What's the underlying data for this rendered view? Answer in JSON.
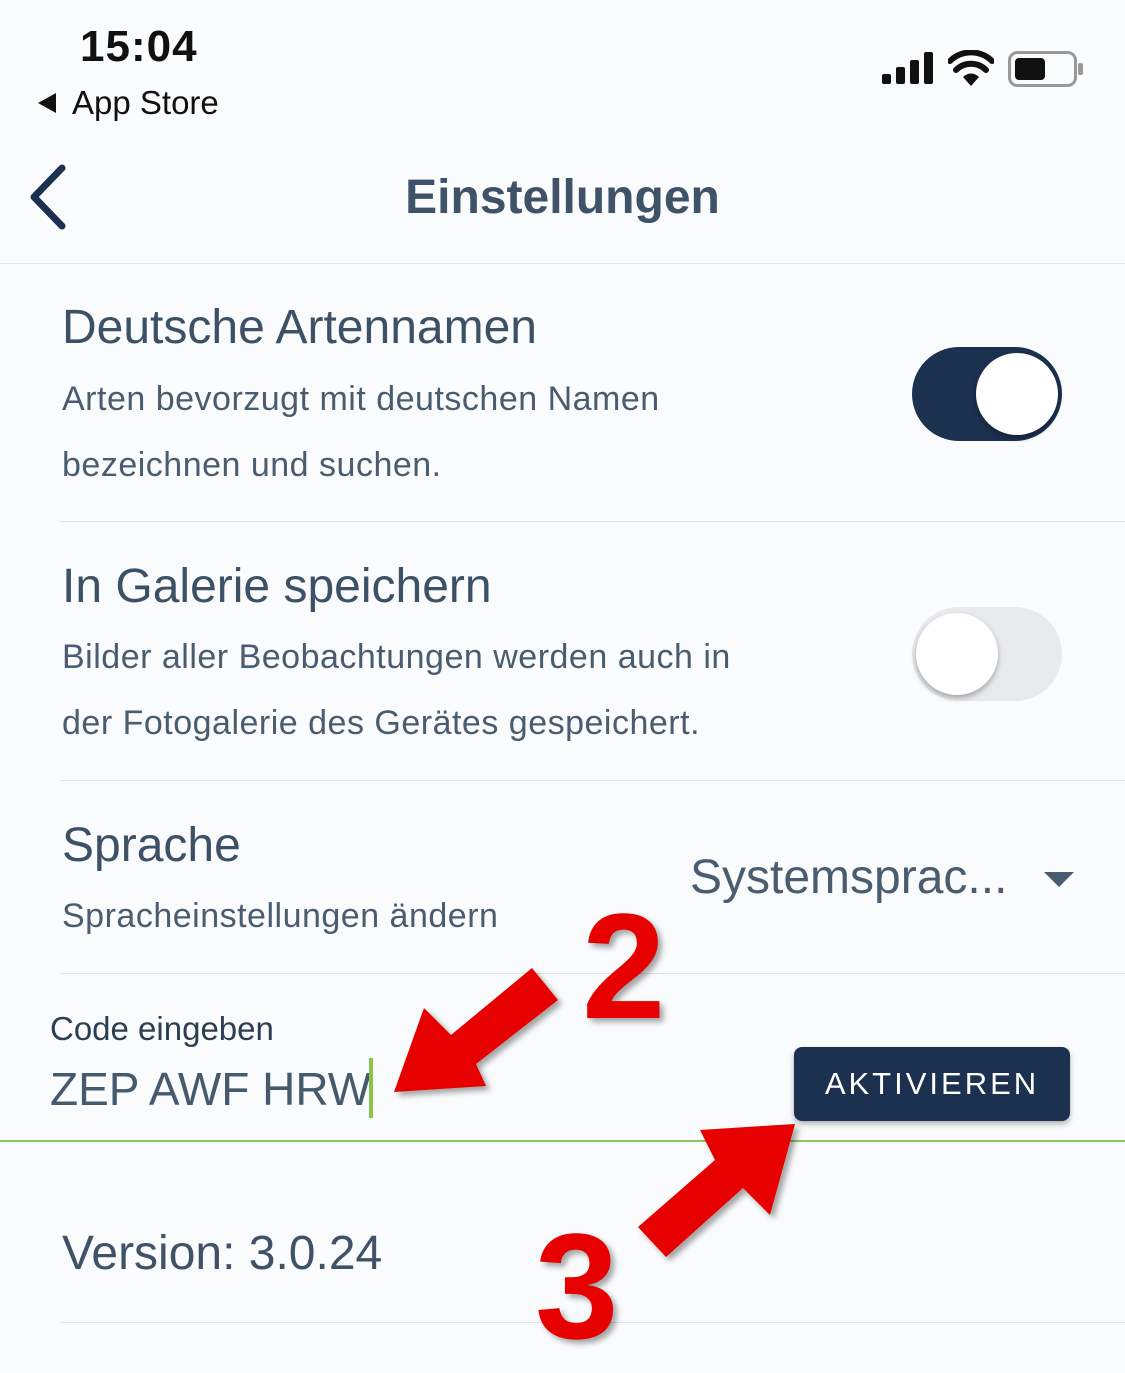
{
  "status_bar": {
    "time": "15:04",
    "back_app": "App Store"
  },
  "nav": {
    "title": "Einstellungen"
  },
  "settings": [
    {
      "title": "Deutsche Artennamen",
      "desc1": "Arten bevorzugt mit deutschen Namen",
      "desc2": "bezeichnen und suchen.",
      "toggle": true
    },
    {
      "title": "In Galerie speichern",
      "desc1": "Bilder aller Beobachtungen werden auch in",
      "desc2": "der Fotogalerie des Gerätes gespeichert.",
      "toggle": false
    }
  ],
  "language": {
    "title": "Sprache",
    "desc": "Spracheinstellungen ändern",
    "selected": "Systemsprac..."
  },
  "code": {
    "label": "Code eingeben",
    "value": "ZEP AWF HRW",
    "button": "AKTIVIEREN"
  },
  "version": "Version: 3.0.24",
  "annotations": {
    "step2": "2",
    "step3": "3"
  },
  "colors": {
    "accent": "#1c3050",
    "input_underline": "#8fc56a",
    "annotation": "#e60000"
  }
}
